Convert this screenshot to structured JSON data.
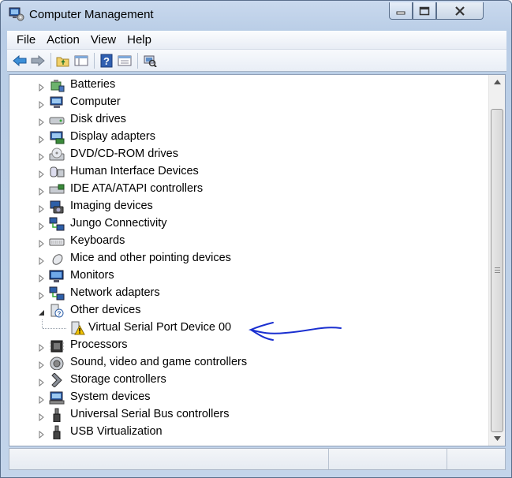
{
  "window": {
    "title": "Computer Management"
  },
  "menubar": {
    "items": [
      "File",
      "Action",
      "View",
      "Help"
    ]
  },
  "toolbar": {
    "buttons": [
      "back-icon",
      "forward-icon",
      "up-folder-icon",
      "show-hide-tree-icon",
      "help-icon",
      "properties-icon",
      "scan-hardware-icon"
    ]
  },
  "tree": {
    "categories": [
      {
        "label": "Batteries",
        "icon": "battery-icon",
        "expanded": false
      },
      {
        "label": "Computer",
        "icon": "computer-icon",
        "expanded": false
      },
      {
        "label": "Disk drives",
        "icon": "disk-drive-icon",
        "expanded": false
      },
      {
        "label": "Display adapters",
        "icon": "display-adapter-icon",
        "expanded": false
      },
      {
        "label": "DVD/CD-ROM drives",
        "icon": "dvd-drive-icon",
        "expanded": false
      },
      {
        "label": "Human Interface Devices",
        "icon": "hid-icon",
        "expanded": false
      },
      {
        "label": "IDE ATA/ATAPI controllers",
        "icon": "ide-controller-icon",
        "expanded": false
      },
      {
        "label": "Imaging devices",
        "icon": "camera-icon",
        "expanded": false
      },
      {
        "label": "Jungo Connectivity",
        "icon": "network-icon",
        "expanded": false
      },
      {
        "label": "Keyboards",
        "icon": "keyboard-icon",
        "expanded": false
      },
      {
        "label": "Mice and other pointing devices",
        "icon": "mouse-icon",
        "expanded": false
      },
      {
        "label": "Monitors",
        "icon": "monitor-icon",
        "expanded": false
      },
      {
        "label": "Network adapters",
        "icon": "network-adapter-icon",
        "expanded": false
      },
      {
        "label": "Other devices",
        "icon": "unknown-device-icon",
        "expanded": true,
        "children": [
          {
            "label": "Virtual Serial Port Device 00",
            "icon": "warning-device-icon"
          }
        ]
      },
      {
        "label": "Processors",
        "icon": "processor-icon",
        "expanded": false
      },
      {
        "label": "Sound, video and game controllers",
        "icon": "speaker-icon",
        "expanded": false
      },
      {
        "label": "Storage controllers",
        "icon": "storage-controller-icon",
        "expanded": false
      },
      {
        "label": "System devices",
        "icon": "system-device-icon",
        "expanded": false
      },
      {
        "label": "Universal Serial Bus controllers",
        "icon": "usb-icon",
        "expanded": false
      },
      {
        "label": "USB Virtualization",
        "icon": "usb-icon",
        "expanded": false
      }
    ]
  },
  "colors": {
    "annotation_arrow": "#1a2fd0",
    "warning": "#f3c400"
  }
}
